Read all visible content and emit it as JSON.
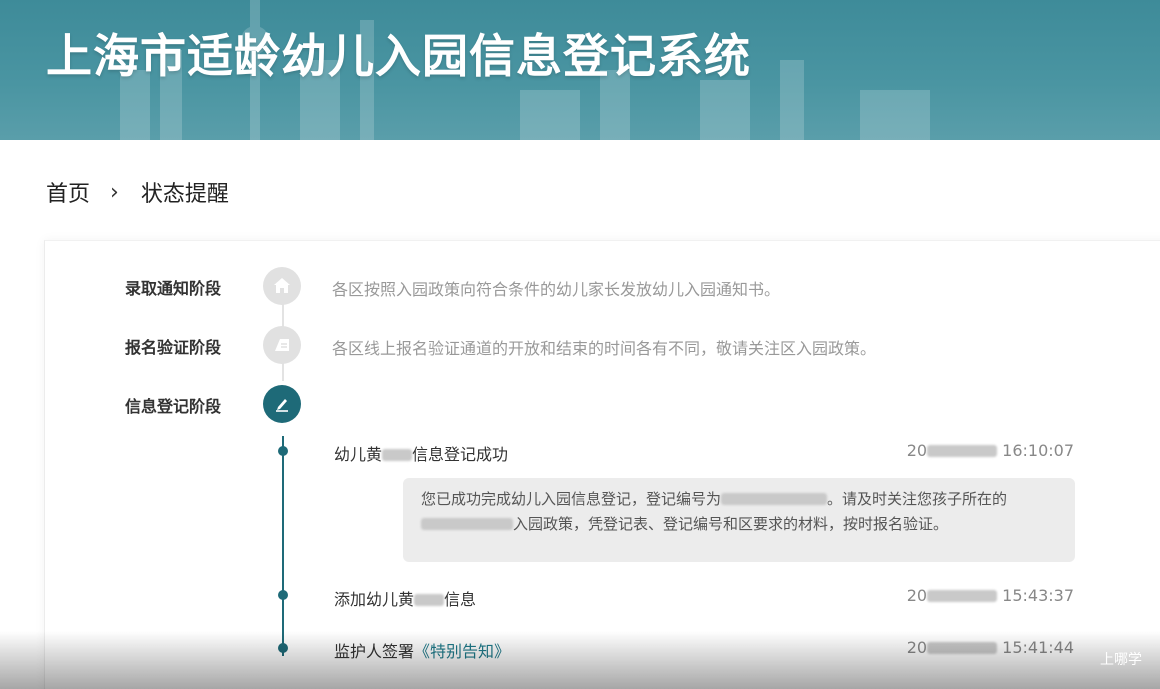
{
  "banner": {
    "title": "上海市适龄幼儿入园信息登记系统"
  },
  "breadcrumb": {
    "home": "首页",
    "separator": "›",
    "current": "状态提醒"
  },
  "stages": [
    {
      "label": "录取通知阶段",
      "description": "各区按照入园政策向符合条件的幼儿家长发放幼儿入园通知书。",
      "icon": "house-icon",
      "active": false
    },
    {
      "label": "报名验证阶段",
      "description": "各区线上报名验证通道的开放和结束的时间各有不同，敬请关注区入园政策。",
      "icon": "document-icon",
      "active": false
    },
    {
      "label": "信息登记阶段",
      "description": "",
      "icon": "pen-icon",
      "active": true
    }
  ],
  "events": [
    {
      "title_prefix": "幼儿黄",
      "title_suffix": "信息登记成功",
      "time_prefix": "20",
      "time": "16:10:07"
    },
    {
      "title_prefix": "添加幼儿黄",
      "title_suffix": "信息",
      "time_prefix": "20",
      "time": "15:43:37"
    },
    {
      "title_prefix": "监护人签署",
      "title_link": "《特别告知》",
      "time_prefix": "20",
      "time": "15:41:44"
    }
  ],
  "message": {
    "part1": "您已成功完成幼儿入园信息登记，登记编号为",
    "part2": "。请及时关注您孩子所在的",
    "part3": "入园政策，凭登记表、登记编号和区要求的材料，按时报名验证。"
  },
  "watermark": "上哪学",
  "colors": {
    "banner": "#4a95a2",
    "accent": "#1e6a78",
    "inactive_icon": "#e1e1e1",
    "message_bg": "#ececec"
  }
}
